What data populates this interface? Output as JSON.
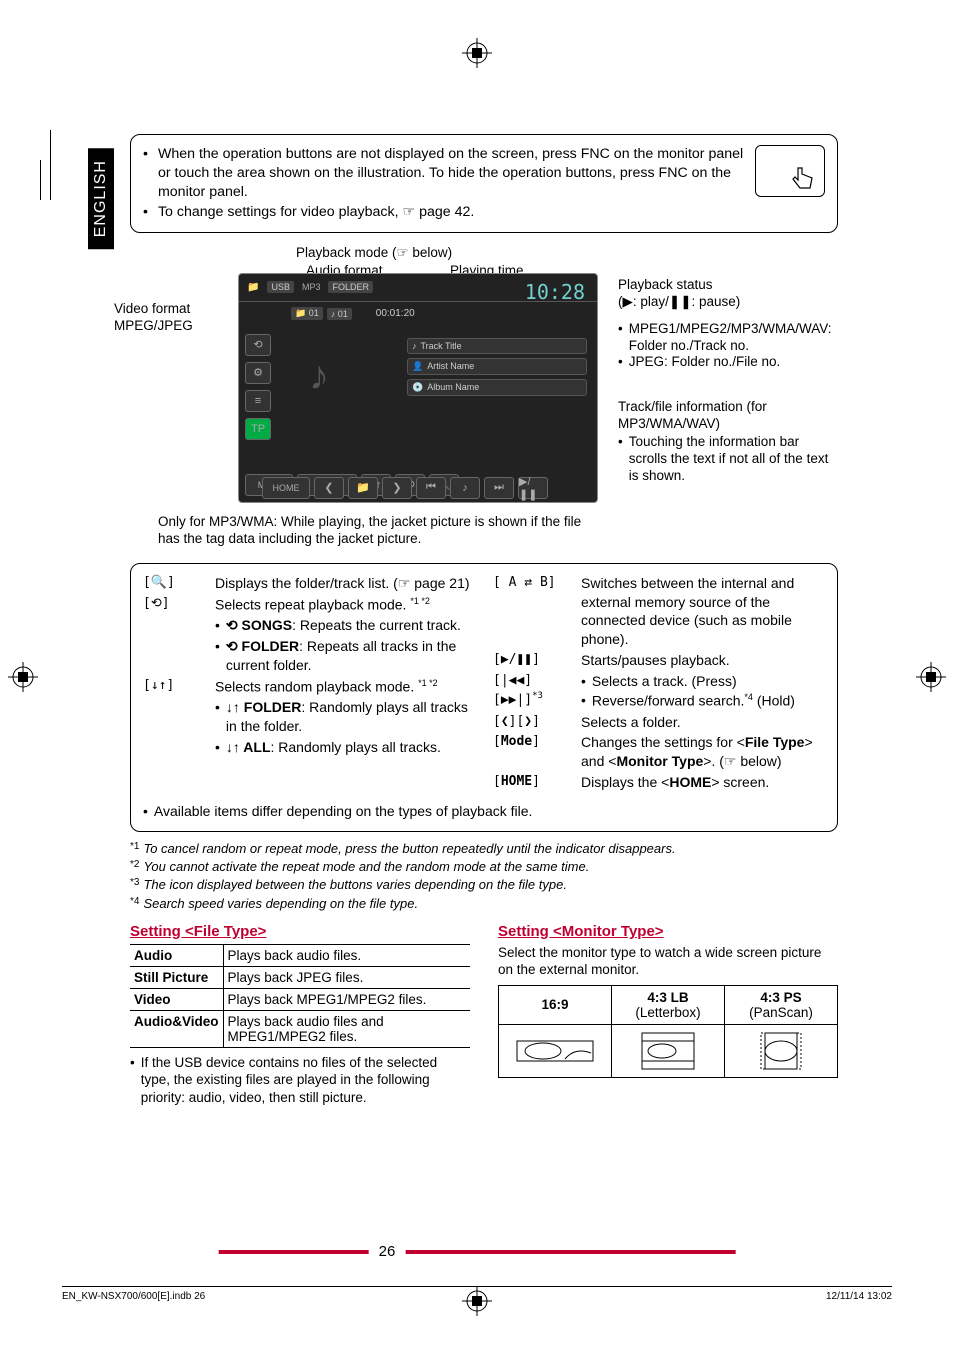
{
  "language_tab": "ENGLISH",
  "top_notes": {
    "n1": "When the operation buttons are not displayed on the screen, press FNC on the monitor panel or touch the area shown on the illustration. To hide the operation buttons, press FNC on the monitor panel.",
    "n2": "To change settings for video playback, ☞ page 42."
  },
  "diagram": {
    "playback_mode": "Playback mode (☞ below)",
    "audio_format": "Audio format",
    "playing_time": "Playing time",
    "video_format": "Video format",
    "mpeg_jpeg": "MPEG/JPEG",
    "playback_status_l1": "Playback status",
    "playback_status_l2": "(▶: play/❚❚: pause)",
    "info1": "MPEG1/MPEG2/MP3/WMA/WAV: Folder no./Track no.",
    "info2": "JPEG: Folder no./File no.",
    "track_info_l1": "Track/file information (for MP3/WMA/WAV)",
    "track_info_l2": "Touching the information bar scrolls the text if not all of the text is shown.",
    "jacket_note": "Only for MP3/WMA: While playing, the jacket picture is shown if the file has the tag data including the jacket picture.",
    "ui": {
      "usb": "USB",
      "folder_badge": "FOLDER",
      "folder_num": "01",
      "track_num": "01",
      "elapsed": "00:01:20",
      "clock": "10:28",
      "track_title": "Track Title",
      "artist_name": "Artist Name",
      "album_name": "Album Name",
      "tp": "TP",
      "mode": "Mode",
      "ab": "A⇄B",
      "home": "HOME"
    }
  },
  "controls": {
    "l1_icon": "[🔍]",
    "l1": "Displays the folder/track list. (☞ page 21)",
    "l2_icon": "[⟲]",
    "l2": "Selects repeat playback mode. ",
    "l2_sup": "*1 *2",
    "l2s1": "SONGS: Repeats the current track.",
    "l2s1_b": "⟲ SONGS",
    "l2s2": "FOLDER: Repeats all tracks in the current folder.",
    "l2s2_b": "⟲ FOLDER",
    "l3_icon": "[↓↑]",
    "l3": "Selects random playback mode. ",
    "l3_sup": "*1 *2",
    "l3s1_b": "↓↑ FOLDER",
    "l3s1": ": Randomly plays all tracks in the folder.",
    "l3s2_b": "↓↑ ALL",
    "l3s2": ": Randomly plays all tracks.",
    "r1_icon": "[ A ⇄ B]",
    "r1": "Switches between the internal and external memory source of the connected device (such as mobile phone).",
    "r2_icon": "[▶/❚❚]",
    "r2": "Starts/pauses playback.",
    "r3_icon": "[|◀◀][▶▶|]",
    "r3_sup": "*3",
    "r3s1": "Selects a track. (Press)",
    "r3s2_pre": "Reverse/forward search.",
    "r3s2_sup": "*4",
    "r3s2_post": " (Hold)",
    "r4_icon": "[❮][❯]",
    "r4": "Selects a folder.",
    "r5_icon": "[Mode]",
    "r5_pre": "Changes the settings for <",
    "r5_b1": "File Type",
    "r5_mid": "> and <",
    "r5_b2": "Monitor Type",
    "r5_post": ">. (☞ below)",
    "r6_icon": "[HOME]",
    "r6_pre": "Displays the <",
    "r6_b": "HOME",
    "r6_post": "> screen.",
    "avail": "Available items differ depending on the types of playback file."
  },
  "footnotes": {
    "f1m": "*1",
    "f1": "To cancel random or repeat mode, press the button repeatedly until the indicator disappears.",
    "f2m": "*2",
    "f2": "You cannot activate the repeat mode and the random mode at the same time.",
    "f3m": "*3",
    "f3": "The icon displayed between the buttons varies depending on the file type.",
    "f4m": "*4",
    "f4": "Search speed varies depending on the file type."
  },
  "file_type": {
    "heading": "Setting <File Type>",
    "rows": {
      "audio_k": "Audio",
      "audio_v": "Plays back audio files.",
      "still_k": "Still Picture",
      "still_v": "Plays back JPEG files.",
      "video_k": "Video",
      "video_v": "Plays back MPEG1/MPEG2 files.",
      "av_k": "Audio&Video",
      "av_v": "Plays back audio files and MPEG1/MPEG2 files."
    },
    "note": "If the USB device contains no files of the selected type, the existing files are played in the following priority: audio, video, then still picture."
  },
  "monitor_type": {
    "heading": "Setting <Monitor Type>",
    "intro": "Select the monitor type to watch a wide screen picture on the external monitor.",
    "h1": "16:9",
    "h2a": "4:3 LB",
    "h2b": "(Letterbox)",
    "h3a": "4:3 PS",
    "h3b": "(PanScan)"
  },
  "page_number": "26",
  "footer": {
    "left": "EN_KW-NSX700/600[E].indb   26",
    "right": "12/11/14   13:02"
  }
}
